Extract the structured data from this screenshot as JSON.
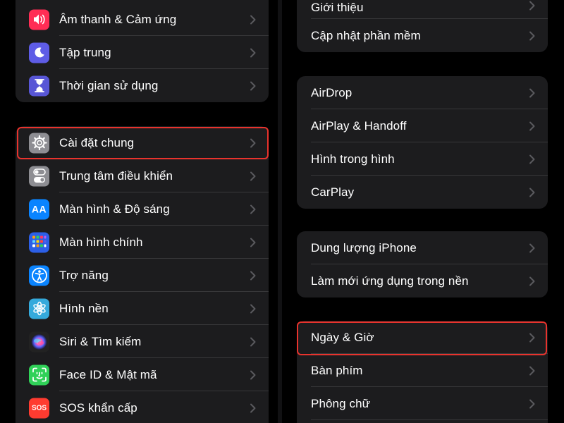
{
  "left": {
    "group_top": [
      {
        "label": "Âm thanh & Cảm ứng",
        "icon": "speaker-icon",
        "color": "#ff2d55"
      },
      {
        "label": "Tập trung",
        "icon": "moon-icon",
        "color": "#5e5ce6"
      },
      {
        "label": "Thời gian sử dụng",
        "icon": "hourglass-icon",
        "color": "#5856d6"
      }
    ],
    "group_main": [
      {
        "label": "Cài đặt chung",
        "icon": "gear-icon",
        "color": "#8e8e93",
        "highlighted": true
      },
      {
        "label": "Trung tâm điều khiển",
        "icon": "toggles-icon",
        "color": "#8e8e93"
      },
      {
        "label": "Màn hình & Độ sáng",
        "icon": "text-size-icon",
        "icon_text": "AA",
        "color": "#0a84ff"
      },
      {
        "label": "Màn hình chính",
        "icon": "app-grid-icon",
        "color": "#2c5fe6"
      },
      {
        "label": "Trợ năng",
        "icon": "accessibility-icon",
        "color": "#0a84ff"
      },
      {
        "label": "Hình nền",
        "icon": "flower-icon",
        "color": "#35aadc"
      },
      {
        "label": "Siri & Tìm kiếm",
        "icon": "siri-icon",
        "color": "#222222"
      },
      {
        "label": "Face ID & Mật mã",
        "icon": "face-id-icon",
        "color": "#30d158"
      },
      {
        "label": "SOS khẩn cấp",
        "icon": "sos-icon",
        "icon_text": "SOS",
        "color": "#ff3b30"
      }
    ]
  },
  "right": {
    "group_about": [
      {
        "label": "Giới thiệu"
      },
      {
        "label": "Cập nhật phần mềm"
      }
    ],
    "group_connect": [
      {
        "label": "AirDrop"
      },
      {
        "label": "AirPlay & Handoff"
      },
      {
        "label": "Hình trong hình"
      },
      {
        "label": "CarPlay"
      }
    ],
    "group_storage": [
      {
        "label": "Dung lượng iPhone"
      },
      {
        "label": "Làm mới ứng dụng trong nền"
      }
    ],
    "group_locale": [
      {
        "label": "Ngày & Giờ",
        "highlighted": true
      },
      {
        "label": "Bàn phím"
      },
      {
        "label": "Phông chữ"
      }
    ]
  },
  "colors": {
    "highlight": "#e8332d",
    "cell_background": "#1c1c1e",
    "separator": "#38383a",
    "chevron": "#5a5a5e"
  }
}
